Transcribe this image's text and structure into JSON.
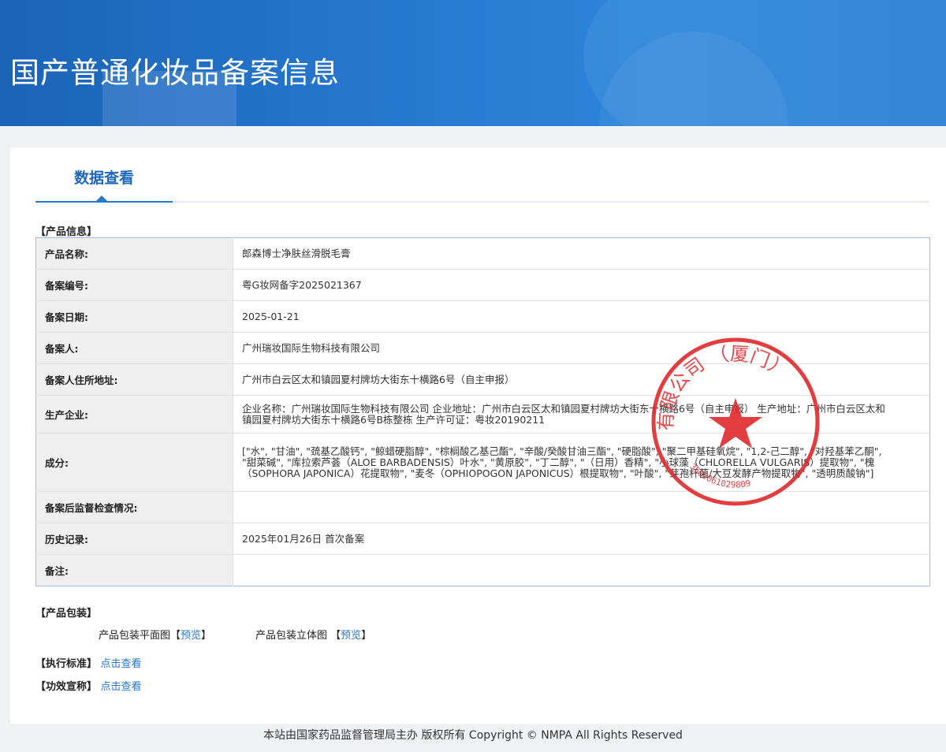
{
  "header": {
    "title": "国产普通化妆品备案信息"
  },
  "tabs": [
    {
      "label": "数据查看"
    }
  ],
  "product_info": {
    "section_title": "【产品信息】",
    "rows": [
      {
        "label": "产品名称:",
        "value": "郎森博士净肤丝滑脱毛膏"
      },
      {
        "label": "备案编号:",
        "value": "粤G妆网备字2025021367"
      },
      {
        "label": "备案日期:",
        "value": "2025-01-21"
      },
      {
        "label": "备案人:",
        "value": "广州瑞妆国际生物科技有限公司"
      },
      {
        "label": "备案人住所地址:",
        "value": "广州市白云区太和镇园夏村牌坊大街东十横路6号（自主申报）"
      },
      {
        "label": "生产企业:",
        "value": "企业名称：广州瑞妆国际生物科技有限公司 企业地址：广州市白云区太和镇园夏村牌坊大街东十横路6号（自主申报） 生产地址：广州市白云区太和镇园夏村牌坊大街东十横路6号B栋整栋 生产许可证：粤妆20190211"
      },
      {
        "label": "成分:",
        "value": "[\"水\", \"甘油\", \"巯基乙酸钙\", \"鲸蜡硬脂醇\", \"棕榈酸乙基己酯\", \"辛酸/癸酸甘油三酯\", \"硬脂酸\", \"聚二甲基硅氧烷\", \"1,2-己二醇\", \"对羟基苯乙酮\", \"甜菜碱\", \"库拉索芦荟（ALOE BARBADENSIS）叶水\", \"黄原胶\", \"丁二醇\", \"（日用）香精\", \"小球藻（CHLORELLA VULGARIS）提取物\", \"槐（SOPHORA JAPONICA）花提取物\", \"麦冬（OPHIOPOGON JAPONICUS）根提取物\", \"叶酸\", \"芽孢杆菌/大豆发酵产物提取物\", \"透明质酸钠\"]"
      },
      {
        "label": "备案后监督检查情况:",
        "value": ""
      },
      {
        "label": "历史记录:",
        "value": "2025年01月26日 首次备案"
      },
      {
        "label": "备注:",
        "value": ""
      }
    ]
  },
  "packaging": {
    "section_title": "【产品包装】",
    "flat_label": "产品包装平面图",
    "flat_link": "预览",
    "solid_label": "产品包装立体图",
    "solid_link": "预览",
    "bracket_open": "【",
    "bracket_close": "】"
  },
  "standard": {
    "title": "【执行标准】",
    "link": "点击查看"
  },
  "efficacy": {
    "title": "【功效宣称】",
    "link": "点击查看"
  },
  "seal": {
    "text": "有限公司 （厦门）",
    "number": "3502061029809"
  },
  "footer": {
    "text": "本站由国家药品监督管理局主办 版权所有 Copyright © NMPA All Rights Reserved"
  }
}
